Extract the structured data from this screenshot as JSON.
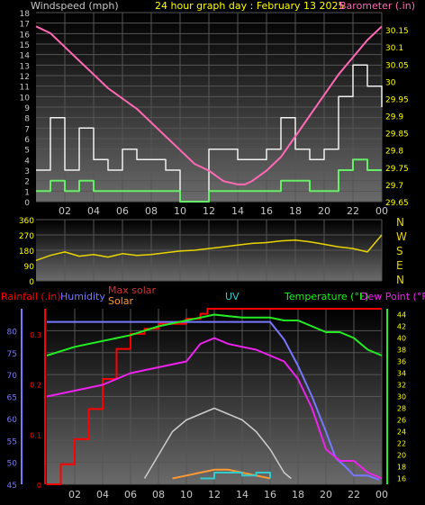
{
  "header": {
    "left_label": "Windspeed (mph)",
    "title": "24 hour graph day : February 13 2025",
    "right_label": "Barometer (.in)"
  },
  "colors": {
    "background": "#000000",
    "title": "#ffff00",
    "gray_axis": "#c8c8c8",
    "barometer": "#ff69b4",
    "wind_gust": "#f0f0f0",
    "wind_avg": "#66ee66",
    "direction": "#e8d400",
    "rain": "#ff0000",
    "humidity": "#7777ff",
    "max_solar": "#cccccc",
    "solar": "#ff9933",
    "uv": "#33cccc",
    "temperature": "#22ee22",
    "dewpoint": "#ee22ee"
  },
  "chart_data": [
    {
      "type": "line",
      "title": "24 hour graph day : February 13 2025",
      "x_ticks": [
        "02",
        "04",
        "06",
        "08",
        "10",
        "12",
        "14",
        "16",
        "18",
        "20",
        "22",
        "00"
      ],
      "x_range_hours": [
        0,
        24
      ],
      "grid": true,
      "y_left": {
        "label": "Windspeed (mph)",
        "range": [
          0,
          18
        ],
        "ticks": [
          "0",
          "1",
          "2",
          "3",
          "4",
          "5",
          "6",
          "7",
          "8",
          "9",
          "10",
          "11",
          "12",
          "13",
          "14",
          "15",
          "16",
          "17",
          "18"
        ]
      },
      "y_right": {
        "label": "Barometer (.in)",
        "range": [
          29.65,
          30.2
        ],
        "ticks": [
          "29.65",
          "29.7",
          "29.75",
          "29.8",
          "29.85",
          "29.9",
          "29.95",
          "30",
          "30.05",
          "30.1",
          "30.15"
        ]
      },
      "series": [
        {
          "name": "Barometer",
          "axis": "right",
          "color": "#ff69b4",
          "x": [
            0,
            1,
            2,
            3,
            4,
            5,
            6,
            7,
            8,
            9,
            10,
            11,
            12,
            13,
            14,
            14.5,
            15,
            16,
            17,
            18,
            19,
            20,
            21,
            22,
            23,
            24
          ],
          "y": [
            30.16,
            30.14,
            30.1,
            30.06,
            30.02,
            29.98,
            29.95,
            29.92,
            29.88,
            29.84,
            29.8,
            29.76,
            29.74,
            29.71,
            29.7,
            29.7,
            29.71,
            29.74,
            29.78,
            29.84,
            29.9,
            29.96,
            30.02,
            30.07,
            30.12,
            30.16
          ]
        },
        {
          "name": "Wind gust",
          "axis": "left",
          "color": "#f0f0f0",
          "x": [
            0,
            1,
            2,
            3,
            4,
            5,
            6,
            7,
            8,
            9,
            10,
            11,
            12,
            13,
            14,
            15,
            16,
            17,
            18,
            19,
            20,
            21,
            22,
            23,
            24
          ],
          "y": [
            3,
            8,
            3,
            7,
            4,
            3,
            5,
            4,
            4,
            3,
            0,
            0,
            5,
            5,
            4,
            4,
            5,
            8,
            5,
            4,
            5,
            10,
            13,
            11,
            9
          ]
        },
        {
          "name": "Wind average",
          "axis": "left",
          "color": "#66ee66",
          "x": [
            0,
            1,
            2,
            3,
            4,
            5,
            6,
            7,
            8,
            9,
            10,
            11,
            12,
            13,
            14,
            15,
            16,
            17,
            18,
            19,
            20,
            21,
            22,
            23,
            24
          ],
          "y": [
            1,
            2,
            1,
            2,
            1,
            1,
            1,
            1,
            1,
            1,
            0,
            0,
            1,
            1,
            1,
            1,
            1,
            2,
            2,
            1,
            1,
            3,
            4,
            3,
            3
          ]
        }
      ]
    },
    {
      "type": "line",
      "y_left": {
        "range": [
          0,
          360
        ],
        "ticks": [
          "0",
          "90",
          "180",
          "270",
          "360"
        ]
      },
      "y_right_labels": [
        "N",
        "W",
        "S",
        "E",
        "N"
      ],
      "series": [
        {
          "name": "Wind direction",
          "color": "#e8d400",
          "x": [
            0,
            1,
            2,
            3,
            4,
            5,
            6,
            7,
            8,
            9,
            10,
            11,
            12,
            13,
            14,
            15,
            16,
            17,
            18,
            19,
            20,
            21,
            22,
            23,
            24
          ],
          "y": [
            120,
            150,
            170,
            145,
            155,
            140,
            160,
            150,
            155,
            165,
            175,
            180,
            190,
            200,
            210,
            220,
            225,
            235,
            240,
            230,
            215,
            200,
            190,
            170,
            270
          ]
        }
      ]
    },
    {
      "type": "line",
      "legend": [
        "Rainfall (.in)",
        "Humidity",
        "Max solar",
        "Solar",
        "UV",
        "Temperature (°F)",
        "Dew Point (°F)"
      ],
      "y_humidity": {
        "range": [
          45,
          85
        ],
        "ticks": [
          "45",
          "50",
          "55",
          "60",
          "65",
          "70",
          "75",
          "80"
        ]
      },
      "y_rain": {
        "range": [
          0,
          0.35
        ],
        "ticks": [
          "0",
          "0.1",
          "0.2",
          "0.3"
        ]
      },
      "y_temp": {
        "range": [
          15,
          45
        ],
        "ticks": [
          "16",
          "18",
          "20",
          "22",
          "24",
          "26",
          "28",
          "30",
          "32",
          "34",
          "36",
          "38",
          "40",
          "42",
          "44"
        ]
      },
      "series": [
        {
          "name": "Rainfall (.in)",
          "axis": "rain",
          "color": "#ff0000",
          "x": [
            0,
            1,
            2,
            3,
            4,
            5,
            6,
            7,
            8,
            9,
            10,
            11,
            11.5,
            12,
            17,
            24
          ],
          "y": [
            0,
            0.04,
            0.09,
            0.15,
            0.21,
            0.27,
            0.3,
            0.31,
            0.32,
            0.32,
            0.33,
            0.34,
            0.35,
            0.35,
            0.35,
            0.35
          ]
        },
        {
          "name": "Humidity",
          "axis": "humidity",
          "color": "#7777ff",
          "x": [
            0,
            8,
            12,
            16,
            17,
            18,
            19,
            20,
            20.7,
            21.4,
            22,
            23,
            23.8
          ],
          "y": [
            82,
            82,
            82,
            82,
            78,
            72,
            65,
            57,
            51,
            49,
            47,
            47,
            46
          ]
        },
        {
          "name": "Temperature (°F)",
          "axis": "temp",
          "color": "#22ee22",
          "x": [
            0,
            2,
            4,
            6,
            8,
            10,
            11,
            12,
            14,
            16,
            17,
            18,
            19,
            20,
            21,
            22,
            23,
            24
          ],
          "y": [
            37,
            38.5,
            39.5,
            40.5,
            42,
            43,
            43.5,
            44,
            43.5,
            43.5,
            43,
            43,
            42,
            41,
            41,
            40,
            38,
            37
          ]
        },
        {
          "name": "Dew Point (°F)",
          "axis": "temp",
          "color": "#ee22ee",
          "x": [
            0,
            2,
            4,
            6,
            8,
            10,
            11,
            12,
            13,
            14,
            15,
            16,
            17,
            18,
            19,
            20,
            21,
            22,
            23,
            24
          ],
          "y": [
            30,
            31,
            32,
            34,
            35,
            36,
            39,
            40,
            39,
            38.5,
            38,
            37,
            36,
            33,
            28,
            21,
            19,
            19,
            17,
            16
          ]
        },
        {
          "name": "Max solar",
          "axis": "temp",
          "color": "#cccccc",
          "x": [
            7,
            8,
            9,
            10,
            11,
            12,
            13,
            14,
            15,
            16,
            17,
            17.5
          ],
          "y": [
            16,
            20,
            24,
            26,
            27,
            28,
            27,
            26,
            24,
            21,
            17,
            16
          ]
        },
        {
          "name": "Solar",
          "axis": "temp",
          "color": "#ff9933",
          "x": [
            9,
            10,
            11,
            12,
            13,
            14,
            15,
            16
          ],
          "y": [
            16,
            16.5,
            17,
            17.5,
            17.5,
            17,
            16.5,
            16
          ]
        },
        {
          "name": "UV",
          "axis": "temp",
          "color": "#33cccc",
          "x": [
            11,
            12,
            13,
            14,
            15,
            16
          ],
          "y": [
            16,
            17,
            17,
            16.5,
            17,
            16
          ]
        }
      ]
    }
  ]
}
